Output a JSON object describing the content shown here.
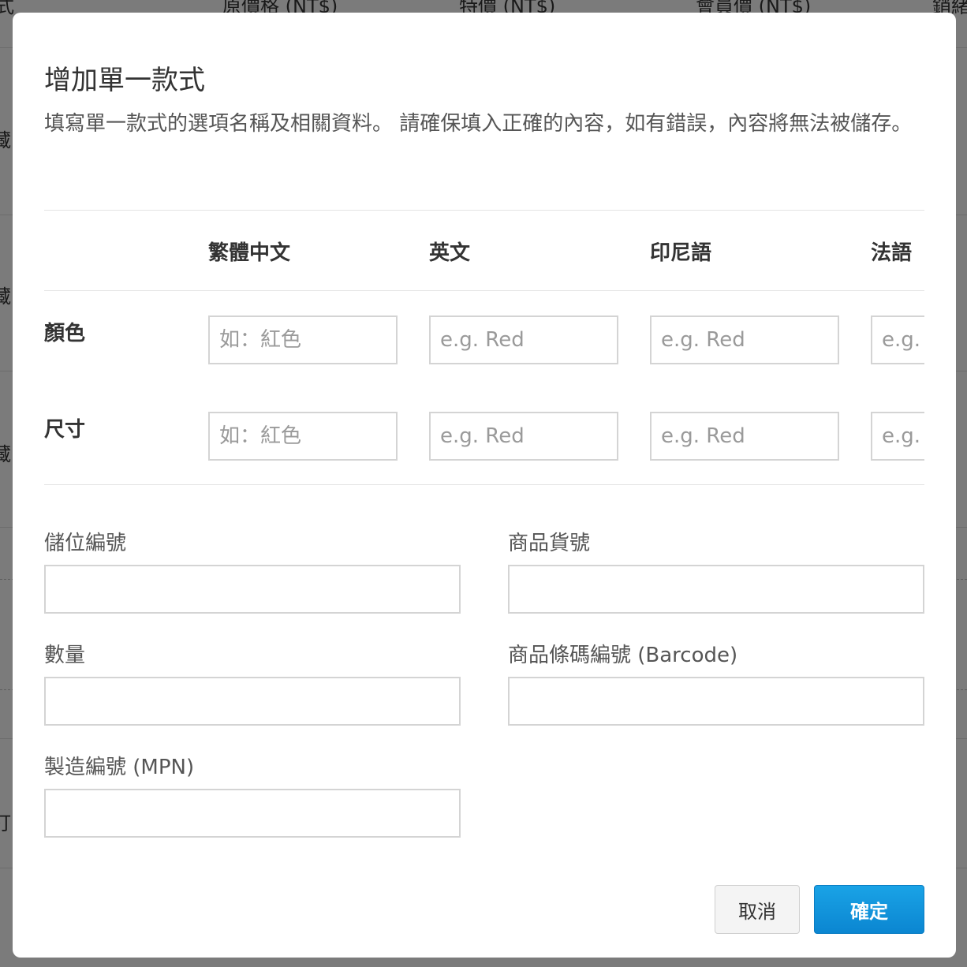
{
  "background": {
    "columns": [
      "原價格 (NT$)",
      "特價 (NT$)",
      "會員價 (NT$)",
      "銷緒"
    ],
    "row_fragments": [
      "藏",
      "藏",
      "藏",
      "打"
    ]
  },
  "modal": {
    "title": "增加單一款式",
    "description": "填寫單一款式的選項名稱及相關資料。 請確保填入正確的內容，如有錯誤，內容將無法被儲存。",
    "languages": [
      "繁體中文",
      "英文",
      "印尼語",
      "法語"
    ],
    "option_rows": [
      {
        "label": "顏色",
        "placeholders": [
          "如：紅色",
          "e.g. Red",
          "e.g. Red",
          "e.g. Red"
        ],
        "values": [
          "",
          "",
          "",
          ""
        ]
      },
      {
        "label": "尺寸",
        "placeholders": [
          "如：紅色",
          "e.g. Red",
          "e.g. Red",
          "e.g. Red"
        ],
        "values": [
          "",
          "",
          "",
          ""
        ]
      }
    ],
    "fields": {
      "storage_no": {
        "label": "儲位編號",
        "value": ""
      },
      "sku": {
        "label": "商品貨號",
        "value": ""
      },
      "quantity": {
        "label": "數量",
        "value": ""
      },
      "barcode": {
        "label": "商品條碼編號 (Barcode)",
        "value": ""
      },
      "mpn": {
        "label": "製造編號 (MPN)",
        "value": ""
      }
    },
    "buttons": {
      "cancel": "取消",
      "confirm": "確定"
    }
  },
  "colors": {
    "primary": "#0b8fd9",
    "border": "#d4d4d4",
    "overlay": "rgba(0,0,0,0.5)"
  }
}
